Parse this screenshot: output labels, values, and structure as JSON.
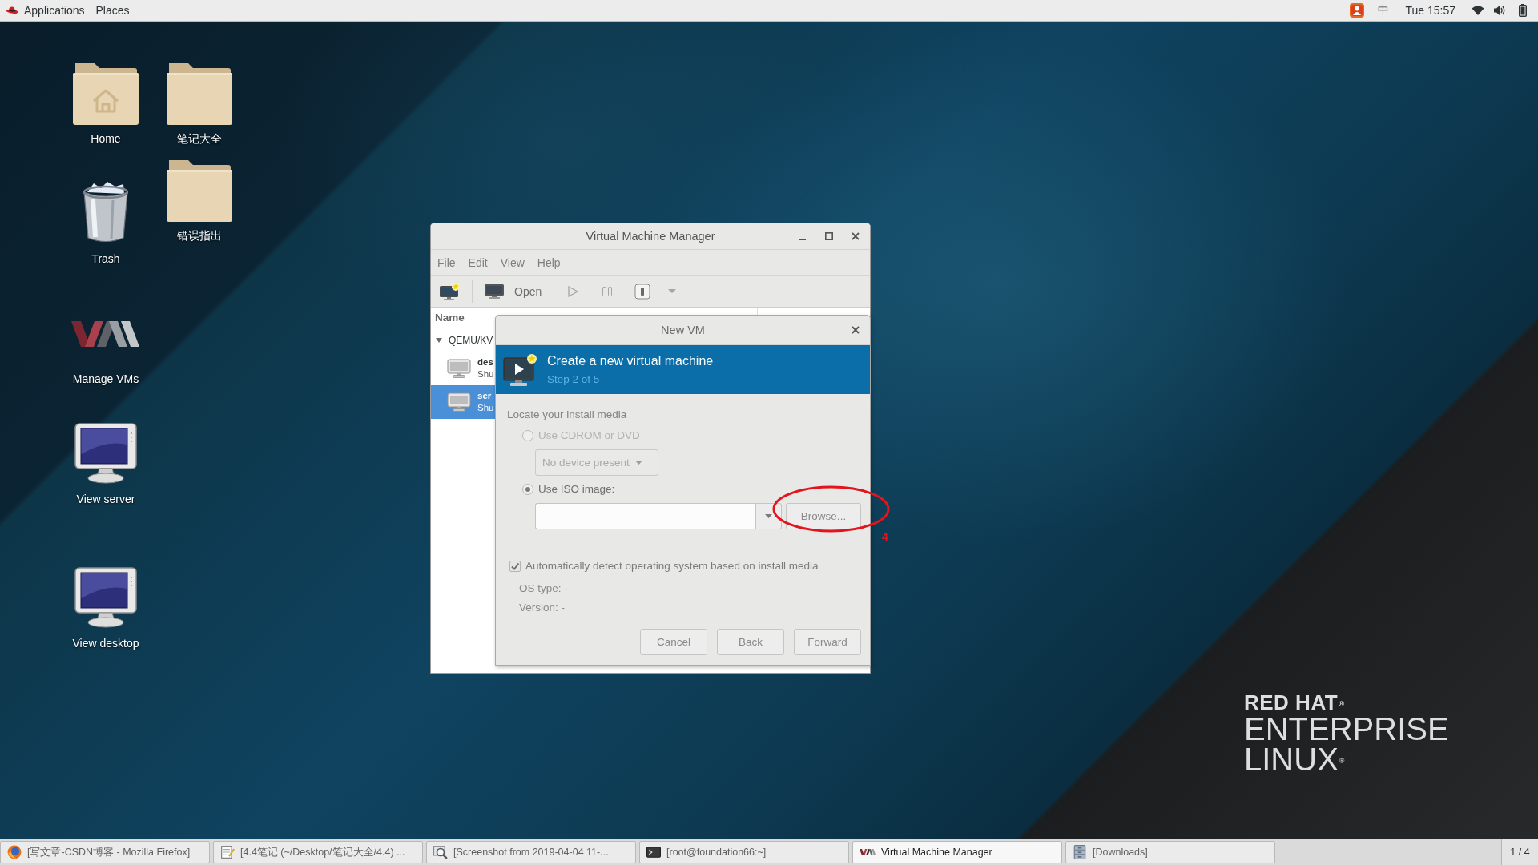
{
  "top_bar": {
    "menus": [
      {
        "label": "Applications",
        "kind": "applications"
      },
      {
        "label": "Places",
        "kind": "places"
      }
    ],
    "input_method": "中",
    "clock": "Tue 15:57"
  },
  "desktop_icons": [
    {
      "label": "Home",
      "kind": "home"
    },
    {
      "label": "Trash",
      "kind": "trash"
    },
    {
      "label": "Manage VMs",
      "kind": "vm-logo"
    },
    {
      "label": "View server",
      "kind": "monitor"
    },
    {
      "label": "View desktop",
      "kind": "monitor"
    },
    {
      "label": "笔记大全",
      "kind": "folder"
    },
    {
      "label": "错误指出",
      "kind": "folder"
    }
  ],
  "vmm_window": {
    "title": "Virtual Machine Manager",
    "menu": [
      "File",
      "Edit",
      "View",
      "Help"
    ],
    "toolbar": [
      {
        "kind": "new",
        "disabled": false
      },
      {
        "kind": "open",
        "label": "Open",
        "disabled": false
      },
      {
        "kind": "run",
        "disabled": true
      },
      {
        "kind": "pause",
        "disabled": true
      },
      {
        "kind": "shutdown",
        "disabled": false
      },
      {
        "kind": "shutdown-menu",
        "disabled": true
      }
    ],
    "columns": [
      "Name"
    ],
    "tree": [
      {
        "label": "QEMU/KV",
        "expanded": true,
        "children": [
          {
            "name": "des",
            "status": "Shu",
            "selected": false
          },
          {
            "name": "ser",
            "status": "Shu",
            "selected": true
          }
        ]
      }
    ]
  },
  "new_vm_dialog": {
    "title": "New VM",
    "header": {
      "title": "Create a new virtual machine",
      "step": "Step 2 of 5"
    },
    "section_label": "Locate your install media",
    "media_options": [
      {
        "kind": "cdrom",
        "label": "Use CDROM or DVD",
        "selected": false,
        "disabled": true,
        "dropdown": {
          "value": "No device present",
          "disabled": true
        }
      },
      {
        "kind": "iso",
        "label": "Use ISO image:",
        "selected": true,
        "disabled": false,
        "browse_button": "Browse..."
      }
    ],
    "auto_detect": {
      "label": "Automatically detect operating system based on install media",
      "checked": true
    },
    "os_details": [
      "OS type: -",
      "Version: -"
    ],
    "buttons": [
      "Cancel",
      "Back",
      "Forward"
    ]
  },
  "annotation": {
    "label": "4"
  },
  "wallpaper_logo": [
    {
      "text": "RED HAT$^{®}$",
      "kind": "bold"
    },
    {
      "text": "ENTERPRISE",
      "kind": "light"
    },
    {
      "text": "LINUX$^{®}$",
      "kind": "light"
    }
  ],
  "taskbar": {
    "items": [
      {
        "label": "[写文章-CSDN博客 - Mozilla Firefox]",
        "kind": "browser",
        "selected": false
      },
      {
        "label": "[4.4笔记 (~/Desktop/笔记大全/4.4) ...",
        "kind": "editor",
        "selected": false
      },
      {
        "label": "[Screenshot from 2019-04-04 11-...",
        "kind": "image-viewer",
        "selected": false
      },
      {
        "label": "[root@foundation66:~]",
        "kind": "terminal",
        "selected": false
      },
      {
        "label": "Virtual Machine Manager",
        "kind": "vm-manager",
        "selected": true
      },
      {
        "label": "[Downloads]",
        "kind": "files",
        "selected": false
      }
    ],
    "workspace": "1 / 4"
  }
}
